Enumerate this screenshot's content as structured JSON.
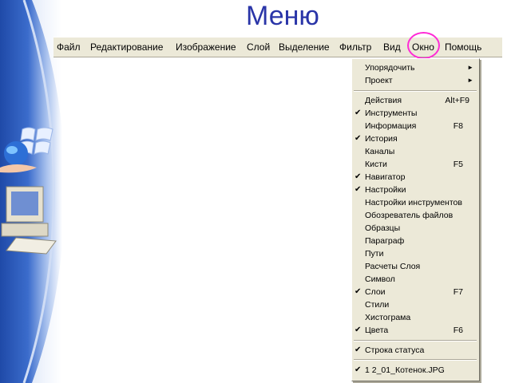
{
  "slide": {
    "title": "Меню"
  },
  "menubar": {
    "items": [
      "Файл",
      "Редактирование",
      "Изображение",
      "Слой",
      "Выделение",
      "Фильтр",
      "Вид",
      "Окно",
      "Помощь"
    ]
  },
  "dropdown": {
    "items": [
      {
        "label": "Упорядочить",
        "submenu": true,
        "arrow": "►"
      },
      {
        "label": "Проект",
        "submenu": true,
        "arrow": "►"
      },
      {
        "label": "Действия",
        "shortcut": "Alt+F9"
      },
      {
        "label": "Инструменты",
        "checked": true,
        "check": "✔"
      },
      {
        "label": "Информация",
        "shortcut": "F8"
      },
      {
        "label": "История",
        "checked": true,
        "check": "✔"
      },
      {
        "label": "Каналы"
      },
      {
        "label": "Кисти",
        "shortcut": "F5"
      },
      {
        "label": "Навигатор",
        "checked": true,
        "check": "✔"
      },
      {
        "label": "Настройки",
        "checked": true,
        "check": "✔"
      },
      {
        "label": "Настройки инструментов"
      },
      {
        "label": "Обозреватель файлов"
      },
      {
        "label": "Образцы"
      },
      {
        "label": "Параграф"
      },
      {
        "label": "Пути"
      },
      {
        "label": "Расчеты Слоя"
      },
      {
        "label": "Символ"
      },
      {
        "label": "Слои",
        "checked": true,
        "check": "✔",
        "shortcut": "F7"
      },
      {
        "label": "Стили"
      },
      {
        "label": "Хистограма"
      },
      {
        "label": "Цвета",
        "checked": true,
        "check": "✔",
        "shortcut": "F6"
      },
      {
        "label": "Строка статуса",
        "checked": true,
        "check": "✔"
      },
      {
        "label": "1 2_01_Котенок.JPG",
        "checked": true,
        "check": "✔"
      }
    ]
  },
  "colors": {
    "highlight_circle": "#ff2bd6",
    "title": "#2a35a8",
    "menu_bg": "#ece9d8"
  }
}
